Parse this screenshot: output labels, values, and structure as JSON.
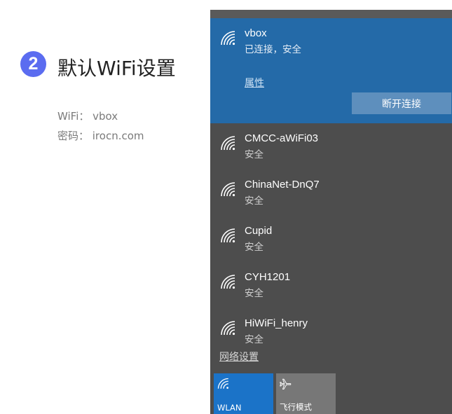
{
  "guide": {
    "step_number": "2",
    "title": "默认WiFi设置",
    "wifi_line": "WiFi： vbox",
    "password_line": "密码： irocn.com"
  },
  "flyout": {
    "connected": {
      "name": "vbox",
      "status": "已连接，安全",
      "properties_link": "属性",
      "disconnect_button": "断开连接",
      "icon": "wifi-icon"
    },
    "networks": [
      {
        "name": "CMCC-aWiFi03",
        "status": "安全",
        "icon": "wifi-icon"
      },
      {
        "name": "ChinaNet-DnQ7",
        "status": "安全",
        "icon": "wifi-icon"
      },
      {
        "name": "Cupid",
        "status": "安全",
        "icon": "wifi-icon"
      },
      {
        "name": "CYH1201",
        "status": "安全",
        "icon": "wifi-icon"
      },
      {
        "name": "HiWiFi_henry",
        "status": "安全",
        "icon": "wifi-icon"
      }
    ],
    "network_settings_link": "网络设置",
    "tiles": {
      "wlan": {
        "label": "WLAN",
        "icon": "wifi-icon"
      },
      "airplane": {
        "label": "飞行模式",
        "icon": "airplane-icon"
      }
    }
  },
  "colors": {
    "badge": "#5b6cf0",
    "connected_bg": "#246aa8",
    "flyout_bg": "#4d4d4d",
    "wlan_tile": "#1b73c8",
    "airplane_tile": "#777777"
  }
}
